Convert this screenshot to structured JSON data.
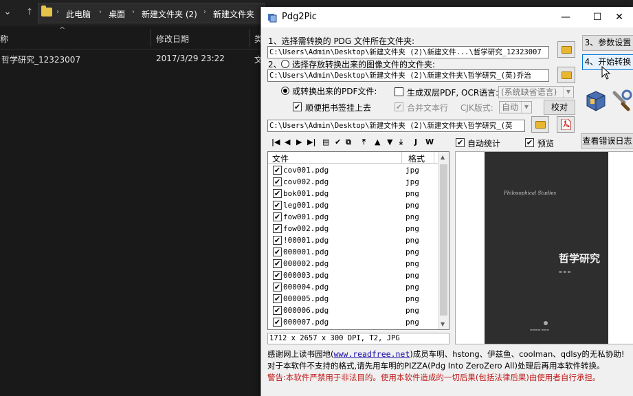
{
  "explorer": {
    "breadcrumb": [
      "此电脑",
      "桌面",
      "新建文件夹 (2)",
      "新建文件夹"
    ],
    "columns": {
      "name": "称",
      "date": "修改日期",
      "type": "类"
    },
    "files": [
      {
        "name": "哲学研究_12323007",
        "date": "2017/3/29 23:22",
        "type": "文"
      }
    ]
  },
  "dialog": {
    "title": "Pdg2Pic",
    "window_controls": {
      "minimize": "—",
      "maximize": "☐",
      "close": "✕"
    },
    "step1_label": "1、选择需转换的 PDG 文件所在文件夹:",
    "source_path": "C:\\Users\\Admin\\Desktop\\新建文件夹 (2)\\新建文件...\\哲学研究_12323007",
    "step2_prefix": "2、",
    "step2_label": "选择存放转换出来的图像文件的文件夹:",
    "image_path": "C:\\Users\\Admin\\Desktop\\新建文件夹 (2)\\新建文件夹\\哲学研究_(英)乔治",
    "pdf_option_label": "或转换出来的PDF文件:",
    "double_layer_label": "生成双层PDF, OCR语言:",
    "ocr_language": "(系统缺省语言)",
    "bookmark_label": "顺便把书签挂上去",
    "merge_label": "合并文本行",
    "cjk_label": "CJK版式:",
    "cjk_value": "自动",
    "proofread_button": "校对",
    "pdf_path": "C:\\Users\\Admin\\Desktop\\新建文件夹 (2)\\新建文件夹\\哲学研究_(英",
    "param_button": "3、参数设置",
    "start_button": "4、开始转换",
    "auto_stats_label": "自动统计",
    "preview_label": "预览",
    "error_log_button": "查看错误日志",
    "list_headers": {
      "file": "文件",
      "format": "格式"
    },
    "file_list": [
      {
        "name": "cov001.pdg",
        "format": "jpg"
      },
      {
        "name": "cov002.pdg",
        "format": "jpg"
      },
      {
        "name": "bok001.pdg",
        "format": "png"
      },
      {
        "name": "leg001.pdg",
        "format": "png"
      },
      {
        "name": "fow001.pdg",
        "format": "png"
      },
      {
        "name": "fow002.pdg",
        "format": "png"
      },
      {
        "name": "!00001.pdg",
        "format": "png"
      },
      {
        "name": "000001.pdg",
        "format": "png"
      },
      {
        "name": "000002.pdg",
        "format": "png"
      },
      {
        "name": "000003.pdg",
        "format": "png"
      },
      {
        "name": "000004.pdg",
        "format": "png"
      },
      {
        "name": "000005.pdg",
        "format": "png"
      },
      {
        "name": "000006.pdg",
        "format": "png"
      },
      {
        "name": "000007.pdg",
        "format": "png"
      }
    ],
    "image_info": "1712 x 2657 x 300 DPI, T2, JPG",
    "book": {
      "subtitle": "Philosophical Studies",
      "title": "哲学研究"
    },
    "footer": {
      "thanks_prefix": "感谢网上读书园地(",
      "link": "www.readfree.net",
      "thanks_suffix": ")成员车明、hstong、伊兹鱼、coolman、qdlsy的无私协助!",
      "note": "对于本软件不支持的格式,请先用车明的PIZZA(Pdg Into ZeroZero All)处理后再用本软件转换。",
      "warning": "警告:本软件严禁用于非法目的。使用本软件造成的一切后果(包括法律后果)由使用者自行承担。"
    }
  }
}
